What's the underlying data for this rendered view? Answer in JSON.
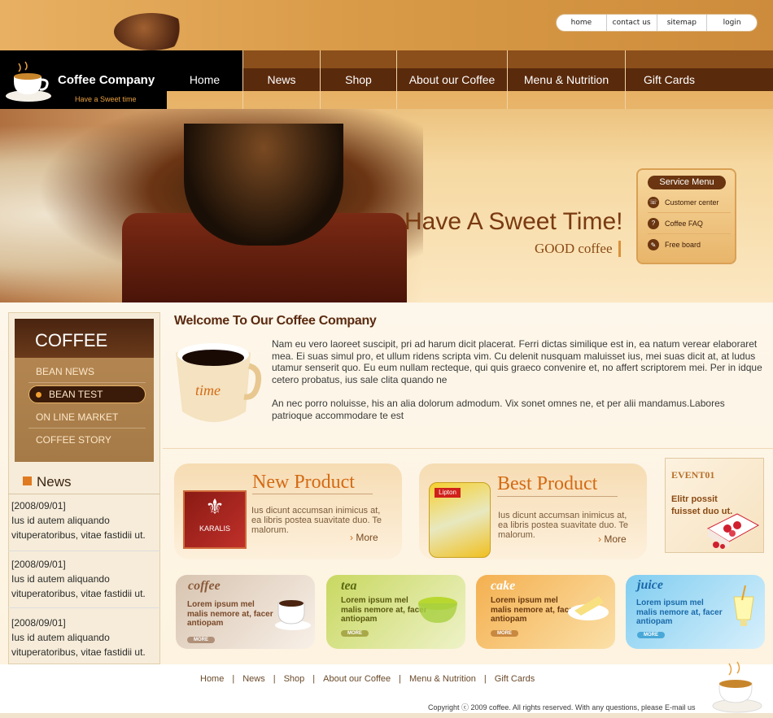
{
  "header": {
    "utility_links": [
      "home",
      "contact us",
      "sitemap",
      "login"
    ],
    "logo": {
      "name": "Coffee Company",
      "tagline": "Have a Sweet time"
    }
  },
  "nav": {
    "items": [
      "Home",
      "News",
      "Shop",
      "About our Coffee",
      "Menu & Nutrition",
      "Gift Cards"
    ],
    "active": "Home"
  },
  "hero": {
    "title": "Have A Sweet Time!",
    "subtitle": "GOOD coffee"
  },
  "service_menu": {
    "title": "Service Menu",
    "items": [
      "Customer center",
      "Coffee FAQ",
      "Free board"
    ]
  },
  "sidebar": {
    "coffee_title": "COFFEE",
    "coffee_menu": [
      "BEAN NEWS",
      "BEAN TEST",
      "ON LINE MARKET",
      "COFFEE STORY"
    ],
    "news_title": "News",
    "news": [
      {
        "date": "[2008/09/01]",
        "text": "Ius id autem aliquando vituperatoribus, vitae fastidii ut."
      },
      {
        "date": "[2008/09/01]",
        "text": "Ius id autem aliquando vituperatoribus, vitae fastidii ut."
      },
      {
        "date": "[2008/09/01]",
        "text": "Ius id autem aliquando vituperatoribus, vitae fastidii ut."
      }
    ]
  },
  "welcome": {
    "title": "Welcome To Our Coffee Company",
    "para1": "Nam eu vero laoreet suscipit, pri ad harum dicit placerat. Ferri dictas similique est in, ea natum verear elaboraret mea. Ei suas simul pro, et ullum ridens scripta vim. Cu delenit nusquam maluisset ius, mei suas dicit at, at ludus utamur senserit quo. Eu eum nullam recteque, qui quis graeco convenire et, no affert scriptorem mei. Per in idque cetero probatus, ius sale clita quando ne",
    "para2": "An nec porro noluisse, his an alia dolorum admodum. Vix sonet omnes ne, et per alii  mandamus.Labores patrioque accommodare te est"
  },
  "products": [
    {
      "title": "New Product",
      "text": "Ius dicunt accumsan inimicus at, ea libris postea suavitate duo. Te malorum.",
      "more": "More",
      "image_label": "KARALIS"
    },
    {
      "title": "Best Product",
      "text": "Ius dicunt accumsan inimicus at, ea libris postea suavitate duo. Te malorum.",
      "more": "More",
      "image_label": "Lipton"
    }
  ],
  "event": {
    "title": "EVENT01",
    "text": "Elitr possit fuisset duo ut."
  },
  "cards": [
    {
      "title": "coffee",
      "text": "Lorem ipsum mel malis nemore at, facer antiopam",
      "more": "MORE",
      "color": "#8a5a3a"
    },
    {
      "title": "tea",
      "text": "Lorem ipsum mel malis nemore at, facer antiopam",
      "more": "MORE",
      "color": "#5a6a10"
    },
    {
      "title": "cake",
      "text": "Lorem ipsum mel malis nemore at, facer antiopam",
      "more": "MORE",
      "color": "#ffffff"
    },
    {
      "title": "juice",
      "text": "Lorem ipsum mel malis nemore at, facer antiopam",
      "more": "MORE",
      "color": "#1a6aaa"
    }
  ],
  "footer": {
    "links": [
      "Home",
      "News",
      "Shop",
      "About our Coffee",
      "Menu & Nutrition",
      "Gift Cards"
    ],
    "copyright": "Copyright ⓒ 2009 coffee. All rights reserved. With any questions, please E-mail us"
  },
  "colors": {
    "brand_dark": "#5a2a0c",
    "accent": "#d46a14"
  }
}
